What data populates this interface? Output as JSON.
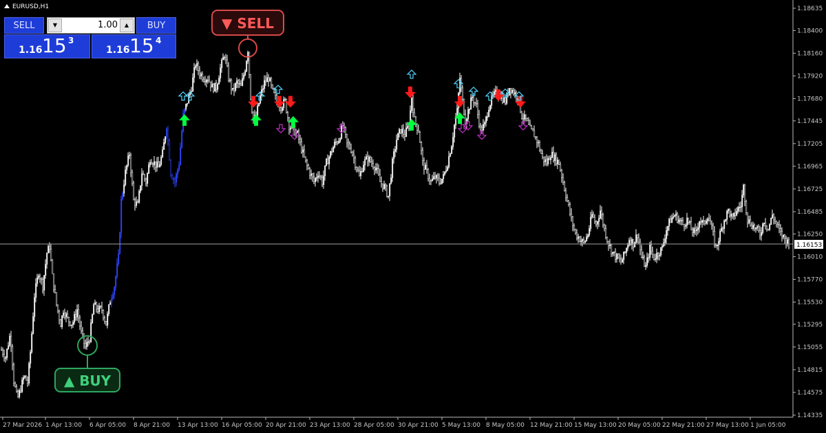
{
  "window": {
    "symbol_title": "EURUSD,H1"
  },
  "trade_panel": {
    "sell_label": "SELL",
    "buy_label": "BUY",
    "lot_value": "1.00",
    "sell_quote": {
      "prefix": "1.16",
      "big": "15",
      "pip": "3"
    },
    "buy_quote": {
      "prefix": "1.16",
      "big": "15",
      "pip": "4"
    }
  },
  "annotations": {
    "sell_label": "▼ SELL",
    "buy_label": "▲ BUY"
  },
  "colors": {
    "background": "#000000",
    "candles": "#ffffff",
    "axis_text": "#c8c8c8",
    "price_line": "#a0a0a0",
    "arrow_up": "#00ff40",
    "arrow_down": "#ff1a1a",
    "hollow_up": "#4fd6ff",
    "hollow_down": "#c030c8",
    "sell_callout": "#d94a4a",
    "buy_callout": "#2fa860",
    "panel_blue": "#1e3cd8"
  },
  "icons": {
    "sell_arrow": "solid-down-arrow-icon",
    "buy_arrow": "solid-up-arrow-icon",
    "hollow_up": "hollow-up-arrow-icon",
    "hollow_down": "hollow-down-arrow-icon"
  },
  "chart_data": {
    "type": "candlestick",
    "symbol": "EURUSD",
    "timeframe": "H1",
    "current_price": "1.16153",
    "ylim": [
      1.1428,
      1.1875
    ],
    "price_ticks": [
      "1.18635",
      "1.18400",
      "1.18160",
      "1.17920",
      "1.17680",
      "1.17445",
      "1.17205",
      "1.16965",
      "1.16725",
      "1.16485",
      "1.16250",
      "1.16010",
      "1.15770",
      "1.15530",
      "1.15295",
      "1.15055",
      "1.14815",
      "1.14575",
      "1.14335"
    ],
    "time_ticks": [
      "27 Mar 2026",
      "1 Apr 13:00",
      "6 Apr 05:00",
      "8 Apr 21:00",
      "13 Apr 13:00",
      "16 Apr 05:00",
      "20 Apr 21:00",
      "23 Apr 13:00",
      "28 Apr 05:00",
      "30 Apr 21:00",
      "5 May 13:00",
      "8 May 05:00",
      "12 May 21:00",
      "15 May 13:00",
      "20 May 05:00",
      "22 May 21:00",
      "27 May 13:00",
      "1 Jun 05:00"
    ],
    "price_path": [
      [
        0,
        1.1505
      ],
      [
        8,
        1.1495
      ],
      [
        15,
        1.152
      ],
      [
        20,
        1.147
      ],
      [
        25,
        1.145
      ],
      [
        30,
        1.1462
      ],
      [
        35,
        1.1475
      ],
      [
        40,
        1.1468
      ],
      [
        44,
        1.15
      ],
      [
        50,
        1.156
      ],
      [
        56,
        1.1585
      ],
      [
        62,
        1.157
      ],
      [
        68,
        1.1605
      ],
      [
        72,
        1.1612
      ],
      [
        76,
        1.158
      ],
      [
        82,
        1.155
      ],
      [
        88,
        1.153
      ],
      [
        92,
        1.1545
      ],
      [
        98,
        1.1535
      ],
      [
        105,
        1.153
      ],
      [
        112,
        1.1545
      ],
      [
        118,
        1.152
      ],
      [
        124,
        1.1505
      ],
      [
        130,
        1.1515
      ],
      [
        136,
        1.155
      ],
      [
        142,
        1.1545
      ],
      [
        148,
        1.1545
      ],
      [
        154,
        1.153
      ],
      [
        160,
        1.1555
      ],
      [
        166,
        1.157
      ],
      [
        172,
        1.16
      ],
      [
        176,
        1.166
      ],
      [
        182,
        1.169
      ],
      [
        188,
        1.171
      ],
      [
        194,
        1.166
      ],
      [
        200,
        1.1655
      ],
      [
        206,
        1.169
      ],
      [
        212,
        1.168
      ],
      [
        218,
        1.1705
      ],
      [
        224,
        1.17
      ],
      [
        230,
        1.1695
      ],
      [
        236,
        1.171
      ],
      [
        242,
        1.174
      ],
      [
        248,
        1.169
      ],
      [
        254,
        1.168
      ],
      [
        260,
        1.17
      ],
      [
        266,
        1.175
      ],
      [
        272,
        1.1765
      ],
      [
        278,
        1.178
      ],
      [
        284,
        1.1805
      ],
      [
        290,
        1.1795
      ],
      [
        296,
        1.179
      ],
      [
        302,
        1.179
      ],
      [
        308,
        1.178
      ],
      [
        314,
        1.178
      ],
      [
        320,
        1.18
      ],
      [
        326,
        1.1815
      ],
      [
        332,
        1.179
      ],
      [
        338,
        1.1775
      ],
      [
        344,
        1.1785
      ],
      [
        350,
        1.178
      ],
      [
        356,
        1.18
      ],
      [
        360,
        1.182
      ],
      [
        364,
        1.177
      ],
      [
        368,
        1.1745
      ],
      [
        372,
        1.175
      ],
      [
        378,
        1.177
      ],
      [
        384,
        1.1785
      ],
      [
        390,
        1.179
      ],
      [
        396,
        1.1775
      ],
      [
        402,
        1.1765
      ],
      [
        408,
        1.176
      ],
      [
        414,
        1.1765
      ],
      [
        420,
        1.174
      ],
      [
        426,
        1.1735
      ],
      [
        432,
        1.173
      ],
      [
        438,
        1.1715
      ],
      [
        444,
        1.17
      ],
      [
        450,
        1.169
      ],
      [
        456,
        1.168
      ],
      [
        462,
        1.169
      ],
      [
        468,
        1.168
      ],
      [
        474,
        1.17
      ],
      [
        480,
        1.171
      ],
      [
        486,
        1.172
      ],
      [
        492,
        1.1725
      ],
      [
        498,
        1.174
      ],
      [
        504,
        1.172
      ],
      [
        510,
        1.1715
      ],
      [
        516,
        1.17
      ],
      [
        522,
        1.1685
      ],
      [
        528,
        1.17
      ],
      [
        534,
        1.1705
      ],
      [
        540,
        1.17
      ],
      [
        546,
        1.1695
      ],
      [
        552,
        1.168
      ],
      [
        558,
        1.1675
      ],
      [
        564,
        1.1665
      ],
      [
        570,
        1.17
      ],
      [
        576,
        1.1725
      ],
      [
        582,
        1.1735
      ],
      [
        588,
        1.173
      ],
      [
        594,
        1.174
      ],
      [
        598,
        1.177
      ],
      [
        602,
        1.1745
      ],
      [
        608,
        1.1735
      ],
      [
        614,
        1.17
      ],
      [
        620,
        1.169
      ],
      [
        626,
        1.168
      ],
      [
        632,
        1.1685
      ],
      [
        638,
        1.168
      ],
      [
        644,
        1.1685
      ],
      [
        650,
        1.17
      ],
      [
        656,
        1.172
      ],
      [
        660,
        1.174
      ],
      [
        664,
        1.1755
      ],
      [
        668,
        1.179
      ],
      [
        672,
        1.1765
      ],
      [
        676,
        1.1745
      ],
      [
        680,
        1.1755
      ],
      [
        686,
        1.177
      ],
      [
        692,
        1.176
      ],
      [
        698,
        1.1735
      ],
      [
        704,
        1.174
      ],
      [
        710,
        1.176
      ],
      [
        716,
        1.177
      ],
      [
        722,
        1.1775
      ],
      [
        728,
        1.177
      ],
      [
        734,
        1.1765
      ],
      [
        740,
        1.178
      ],
      [
        746,
        1.1775
      ],
      [
        752,
        1.177
      ],
      [
        758,
        1.175
      ],
      [
        764,
        1.1745
      ],
      [
        770,
        1.1735
      ],
      [
        776,
        1.173
      ],
      [
        782,
        1.172
      ],
      [
        788,
        1.1705
      ],
      [
        794,
        1.17
      ],
      [
        800,
        1.171
      ],
      [
        806,
        1.1705
      ],
      [
        812,
        1.17
      ],
      [
        818,
        1.168
      ],
      [
        824,
        1.166
      ],
      [
        830,
        1.164
      ],
      [
        836,
        1.1625
      ],
      [
        842,
        1.162
      ],
      [
        848,
        1.1615
      ],
      [
        854,
        1.1625
      ],
      [
        860,
        1.1645
      ],
      [
        866,
        1.1635
      ],
      [
        872,
        1.165
      ],
      [
        878,
        1.163
      ],
      [
        884,
        1.1615
      ],
      [
        890,
        1.1605
      ],
      [
        896,
        1.16
      ],
      [
        902,
        1.1595
      ],
      [
        908,
        1.1605
      ],
      [
        914,
        1.162
      ],
      [
        920,
        1.1615
      ],
      [
        926,
        1.1625
      ],
      [
        932,
        1.16
      ],
      [
        938,
        1.159
      ],
      [
        944,
        1.161
      ],
      [
        950,
        1.16
      ],
      [
        956,
        1.1605
      ],
      [
        962,
        1.161
      ],
      [
        968,
        1.163
      ],
      [
        974,
        1.164
      ],
      [
        980,
        1.1645
      ],
      [
        986,
        1.164
      ],
      [
        992,
        1.1635
      ],
      [
        998,
        1.164
      ],
      [
        1004,
        1.163
      ],
      [
        1010,
        1.1625
      ],
      [
        1016,
        1.164
      ],
      [
        1022,
        1.1635
      ],
      [
        1028,
        1.1645
      ],
      [
        1034,
        1.163
      ],
      [
        1040,
        1.161
      ],
      [
        1046,
        1.1625
      ],
      [
        1052,
        1.164
      ],
      [
        1058,
        1.165
      ],
      [
        1064,
        1.164
      ],
      [
        1070,
        1.165
      ],
      [
        1076,
        1.1655
      ],
      [
        1080,
        1.1675
      ],
      [
        1086,
        1.164
      ],
      [
        1092,
        1.1635
      ],
      [
        1098,
        1.163
      ],
      [
        1104,
        1.1625
      ],
      [
        1110,
        1.164
      ],
      [
        1116,
        1.163
      ],
      [
        1122,
        1.1645
      ],
      [
        1128,
        1.1635
      ],
      [
        1134,
        1.1625
      ],
      [
        1140,
        1.162
      ],
      [
        1146,
        1.1615
      ]
    ],
    "signals": [
      {
        "kind": "up",
        "x": 268,
        "p": 1.1745
      },
      {
        "kind": "up",
        "x": 372,
        "p": 1.1745
      },
      {
        "kind": "up",
        "x": 426,
        "p": 1.1743
      },
      {
        "kind": "up",
        "x": 598,
        "p": 1.174
      },
      {
        "kind": "up",
        "x": 668,
        "p": 1.1747
      },
      {
        "kind": "down",
        "x": 368,
        "p": 1.1765
      },
      {
        "kind": "down",
        "x": 406,
        "p": 1.1765
      },
      {
        "kind": "down",
        "x": 422,
        "p": 1.1765
      },
      {
        "kind": "down",
        "x": 596,
        "p": 1.1775
      },
      {
        "kind": "down",
        "x": 668,
        "p": 1.1765
      },
      {
        "kind": "down",
        "x": 724,
        "p": 1.1772
      },
      {
        "kind": "down",
        "x": 756,
        "p": 1.1765
      },
      {
        "kind": "hup",
        "x": 266,
        "p": 1.177
      },
      {
        "kind": "hup",
        "x": 276,
        "p": 1.177
      },
      {
        "kind": "hup",
        "x": 378,
        "p": 1.177
      },
      {
        "kind": "hup",
        "x": 404,
        "p": 1.1777
      },
      {
        "kind": "hup",
        "x": 598,
        "p": 1.1793
      },
      {
        "kind": "hup",
        "x": 666,
        "p": 1.1783
      },
      {
        "kind": "hup",
        "x": 688,
        "p": 1.1775
      },
      {
        "kind": "hup",
        "x": 712,
        "p": 1.177
      },
      {
        "kind": "hup",
        "x": 734,
        "p": 1.1773
      },
      {
        "kind": "hup",
        "x": 754,
        "p": 1.177
      },
      {
        "kind": "hdn",
        "x": 408,
        "p": 1.1737
      },
      {
        "kind": "hdn",
        "x": 428,
        "p": 1.173
      },
      {
        "kind": "hdn",
        "x": 496,
        "p": 1.1737
      },
      {
        "kind": "hdn",
        "x": 672,
        "p": 1.1737
      },
      {
        "kind": "hdn",
        "x": 680,
        "p": 1.174
      },
      {
        "kind": "hdn",
        "x": 700,
        "p": 1.173
      },
      {
        "kind": "hdn",
        "x": 760,
        "p": 1.174
      }
    ],
    "callouts": {
      "sell": {
        "x": 360,
        "p": 1.182
      },
      "buy": {
        "x": 127,
        "p": 1.151
      }
    }
  }
}
